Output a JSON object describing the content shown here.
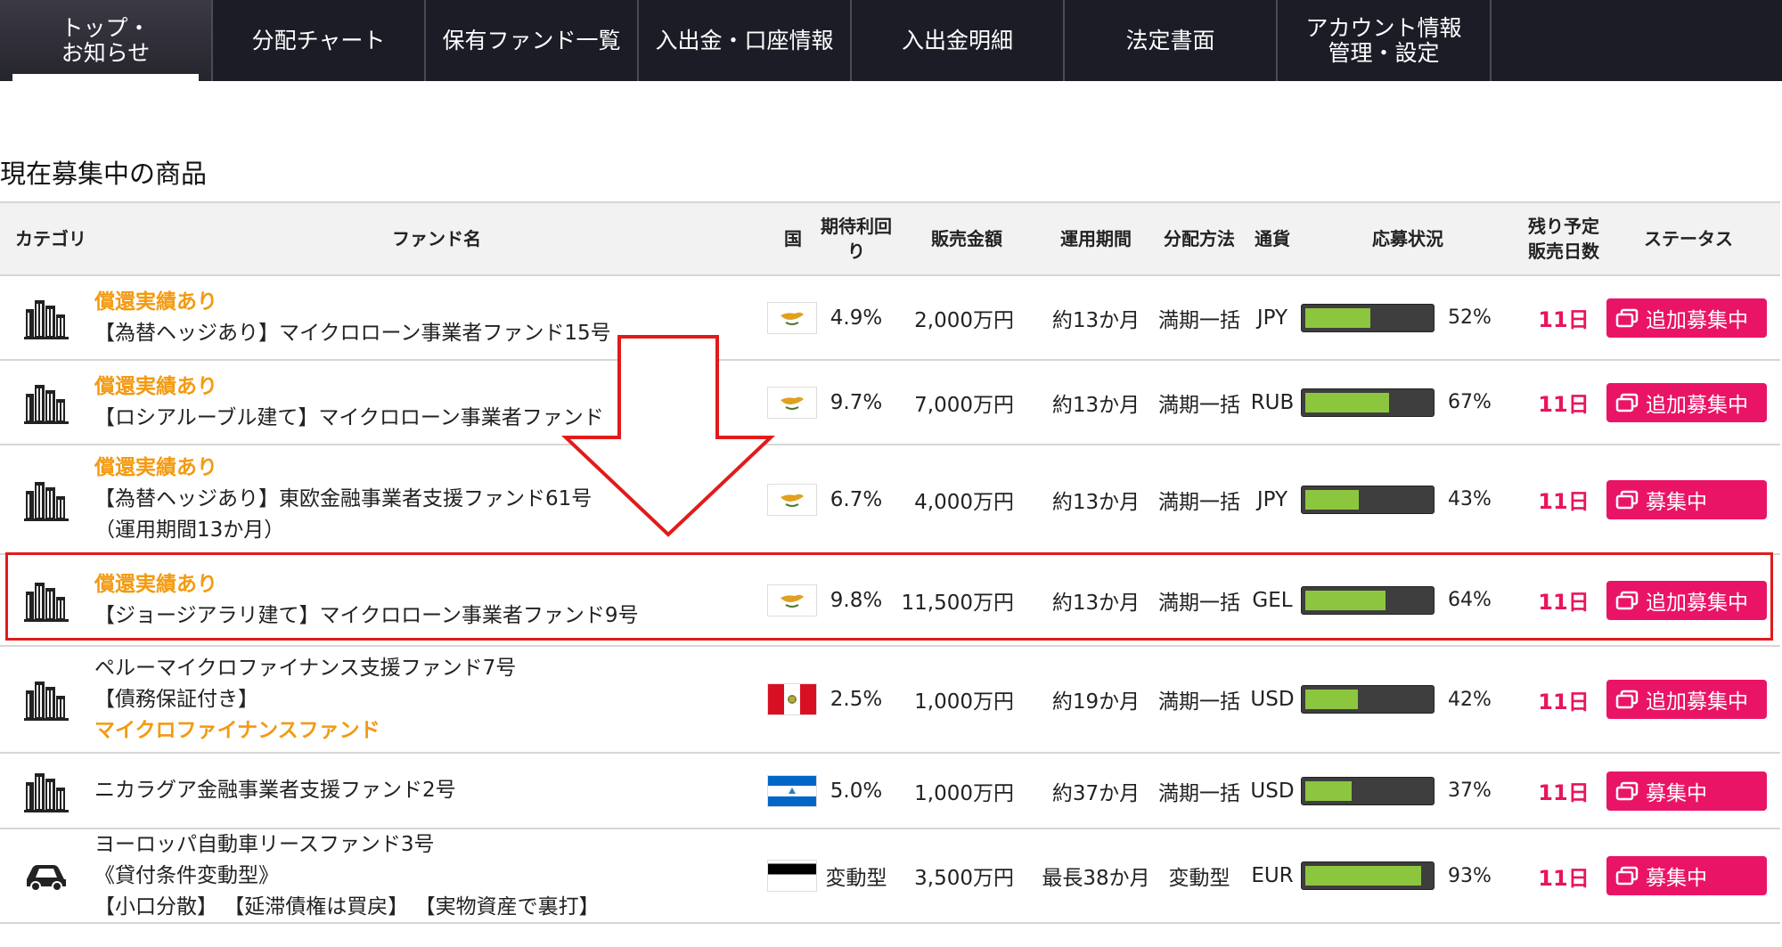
{
  "nav": {
    "items": [
      "トップ・\nお知らせ",
      "分配チャート",
      "保有ファンド一覧",
      "入出金・口座情報",
      "入出金明細",
      "法定書面",
      "アカウント情報\n管理・設定"
    ]
  },
  "section_title": "現在募集中の商品",
  "table": {
    "headers": {
      "category": "カテゴリ",
      "fund_name": "ファンド名",
      "country": "国",
      "yield": "期待利回\nり",
      "amount": "販売金額",
      "period": "運用期間",
      "method": "分配方法",
      "currency": "通貨",
      "application": "応募状況",
      "remaining": "残り予定\n販売日数",
      "status": "ステータス"
    },
    "rows": [
      {
        "category_icon": "building-icon",
        "tag": "償還実績あり",
        "name1": "【為替ヘッジあり】マイクロローン事業者ファンド15号",
        "name2": "",
        "flag": "cyprus-flag",
        "yield": "4.9%",
        "amount": "2,000万円",
        "period": "約13か月",
        "method": "満期一括",
        "currency": "JPY",
        "progress": 52,
        "progress_label": "52%",
        "days": "11日",
        "status": "追加募集中"
      },
      {
        "category_icon": "building-icon",
        "tag": "償還実績あり",
        "name1": "【ロシアルーブル建て】マイクロローン事業者ファンド",
        "name2": "",
        "flag": "cyprus-flag",
        "yield": "9.7%",
        "amount": "7,000万円",
        "period": "約13か月",
        "method": "満期一括",
        "currency": "RUB",
        "progress": 67,
        "progress_label": "67%",
        "days": "11日",
        "status": "追加募集中"
      },
      {
        "category_icon": "building-icon",
        "tag": "償還実績あり",
        "name1": "【為替ヘッジあり】東欧金融事業者支援ファンド61号",
        "name2": "（運用期間13か月）",
        "flag": "cyprus-flag",
        "yield": "6.7%",
        "amount": "4,000万円",
        "period": "約13か月",
        "method": "満期一括",
        "currency": "JPY",
        "progress": 43,
        "progress_label": "43%",
        "days": "11日",
        "status": "募集中"
      },
      {
        "category_icon": "building-icon",
        "tag": "償還実績あり",
        "name1": "【ジョージアラリ建て】マイクロローン事業者ファンド9号",
        "name2": "",
        "flag": "cyprus-flag",
        "yield": "9.8%",
        "amount": "11,500万円",
        "period": "約13か月",
        "method": "満期一括",
        "currency": "GEL",
        "progress": 64,
        "progress_label": "64%",
        "days": "11日",
        "status": "追加募集中"
      },
      {
        "category_icon": "building-icon",
        "tag": "",
        "name1": "ペルーマイクロファイナンス支援ファンド7号",
        "name2": "【債務保証付き】",
        "name3": "マイクロファイナンスファンド",
        "flag": "peru-flag",
        "yield": "2.5%",
        "amount": "1,000万円",
        "period": "約19か月",
        "method": "満期一括",
        "currency": "USD",
        "progress": 42,
        "progress_label": "42%",
        "days": "11日",
        "status": "追加募集中"
      },
      {
        "category_icon": "building-icon",
        "tag": "",
        "name1": "ニカラグア金融事業者支援ファンド2号",
        "name2": "",
        "flag": "nicaragua-flag",
        "yield": "5.0%",
        "amount": "1,000万円",
        "period": "約37か月",
        "method": "満期一括",
        "currency": "USD",
        "progress": 37,
        "progress_label": "37%",
        "days": "11日",
        "status": "募集中"
      },
      {
        "category_icon": "car-icon",
        "tag": "",
        "name1": "ヨーロッパ自動車リースファンド3号",
        "name2": "《貸付条件変動型》",
        "name3": "【小口分散】 【延滞債権は買戻】 【実物資産で裏打】",
        "flag": "estonia-flag",
        "yield": "変動型",
        "amount": "3,500万円",
        "period": "最長38か月",
        "method": "変動型",
        "currency": "EUR",
        "progress": 93,
        "progress_label": "93%",
        "days": "11日",
        "status": "募集中"
      }
    ]
  },
  "colors": {
    "nav_bg": "#1b1c26",
    "accent": "#ea1466",
    "tag": "#f39a12",
    "bar": "#8cc63f",
    "highlight": "#e11b1b"
  }
}
